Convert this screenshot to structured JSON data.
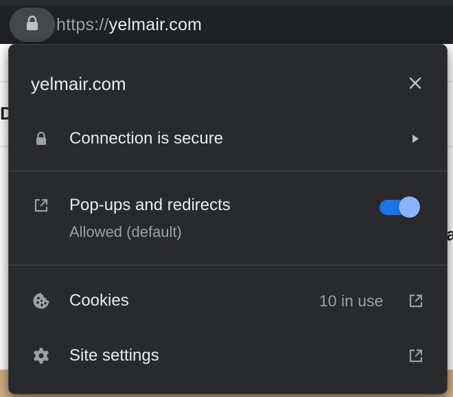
{
  "address_bar": {
    "scheme": "https://",
    "host": "yelmair.com",
    "lock_icon": "lock-icon"
  },
  "popup": {
    "title": "yelmair.com",
    "close_icon": "close-icon",
    "connection": {
      "label": "Connection is secure",
      "icon": "lock-icon",
      "action_icon": "chevron-right-icon"
    },
    "popups": {
      "label": "Pop-ups and redirects",
      "sublabel": "Allowed (default)",
      "icon": "open-in-new-icon",
      "toggle_on": true
    },
    "cookies": {
      "label": "Cookies",
      "count": "10 in use",
      "icon": "cookie-icon",
      "action_icon": "external-link-icon"
    },
    "site_settings": {
      "label": "Site settings",
      "icon": "gear-icon",
      "action_icon": "external-link-icon"
    }
  },
  "colors": {
    "popup_bg": "#292a2d",
    "chrome_bg": "#202124",
    "toggle_track": "#1a73e8",
    "toggle_knob": "#8ab4f8",
    "text_primary": "#e8eaed",
    "text_secondary": "#9aa0a6"
  }
}
